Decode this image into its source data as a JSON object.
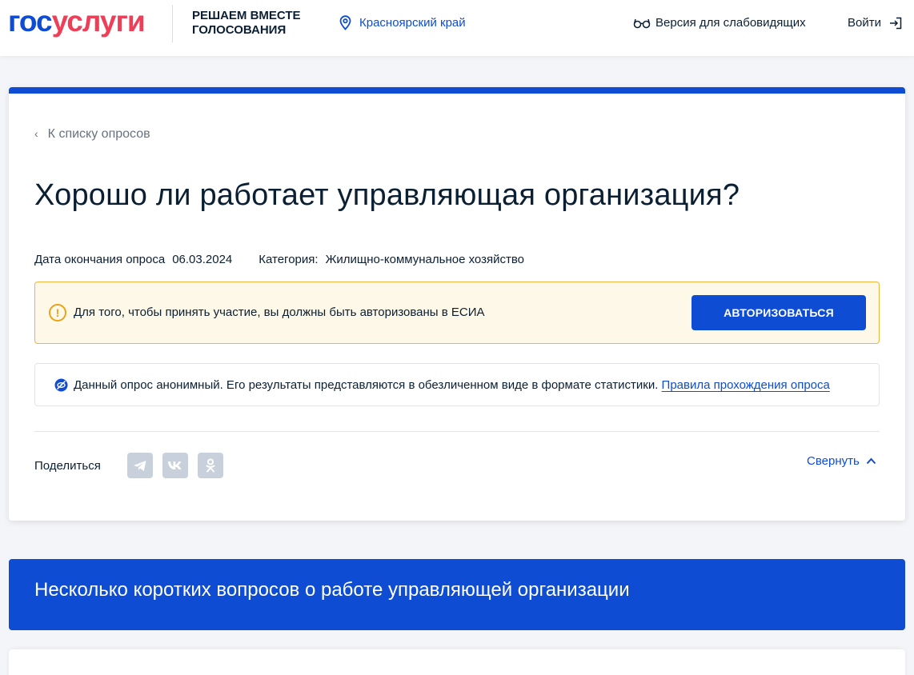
{
  "header": {
    "logo_part1": "гос",
    "logo_part2": "услуги",
    "project_title": "РЕШАЕМ ВМЕСТЕ ГОЛОСОВАНИЯ",
    "region": "Красноярский край",
    "vision_label": "Версия для слабовидящих",
    "login_label": "Войти"
  },
  "poll": {
    "back_label": "К списку опросов",
    "title": "Хорошо ли работает управляющая организация?",
    "end_date_label": "Дата окончания опроса",
    "end_date": "06.03.2024",
    "category_label": "Категория:",
    "category": "Жилищно-коммунальное хозяйство",
    "auth_notice": "Для того, чтобы принять участие, вы должны быть авторизованы в ЕСИА",
    "auth_button": "АВТОРИЗОВАТЬСЯ",
    "anon_notice": "Данный опрос анонимный. Его результаты представляются в обезличенном виде в формате статистики.",
    "rules_link": "Правила прохождения опроса",
    "share_label": "Поделиться",
    "collapse_label": "Свернуть"
  },
  "section": {
    "title": "Несколько коротких вопросов о работе управляющей организации"
  },
  "colors": {
    "accent": "#0d4cd3",
    "logo_red": "#ee3f58",
    "warning_border": "#f0b63c",
    "warning_bg": "#fef8e8"
  },
  "icons": {
    "region": "location-pin-icon",
    "vision": "glasses-icon",
    "login": "login-arrow-icon",
    "back": "chevron-left-icon",
    "warning": "exclamation-circle-icon",
    "anon": "eye-off-icon",
    "share": [
      "telegram-icon",
      "vk-icon",
      "odnoklassniki-icon"
    ],
    "collapse": "chevron-up-icon"
  }
}
